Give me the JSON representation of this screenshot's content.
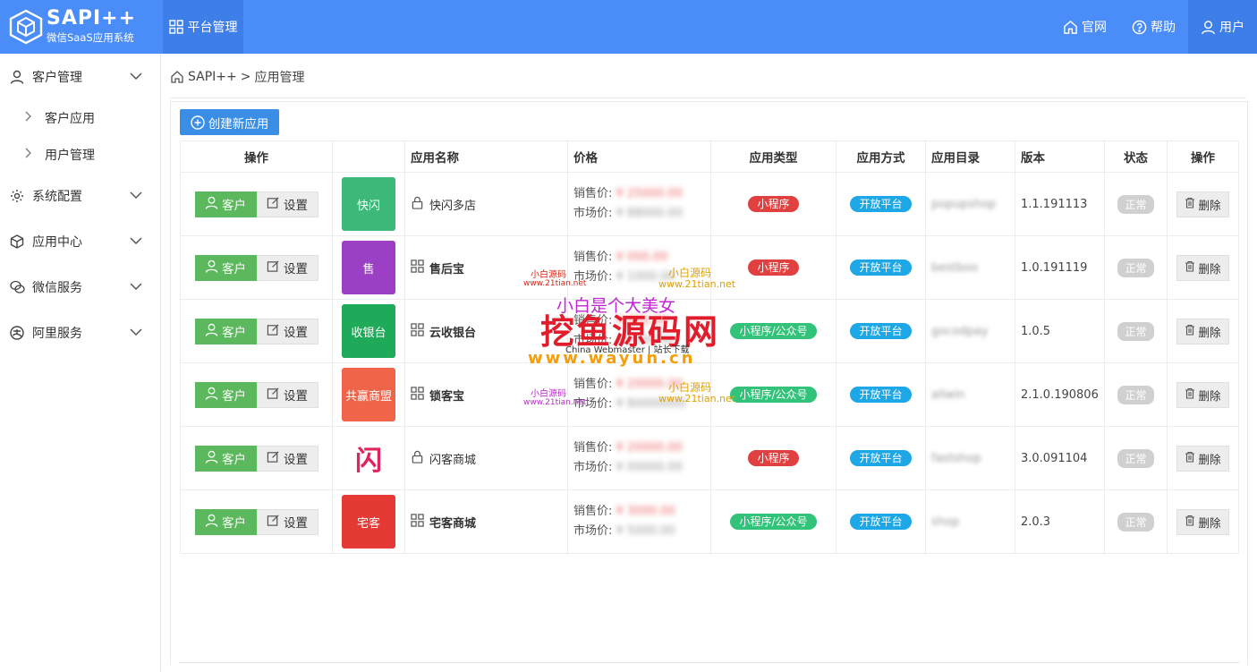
{
  "header": {
    "logo_title": "SAPI++",
    "logo_subtitle": "微信SaaS应用系统",
    "platform_nav": "平台管理",
    "links": [
      {
        "label": "官网",
        "icon": "home-icon"
      },
      {
        "label": "帮助",
        "icon": "help-icon"
      },
      {
        "label": "用户",
        "icon": "user-icon"
      }
    ]
  },
  "sidebar": {
    "groups": [
      {
        "label": "客户管理",
        "icon": "user-icon",
        "children": [
          "客户应用",
          "用户管理"
        ]
      },
      {
        "label": "系统配置",
        "icon": "gear-icon"
      },
      {
        "label": "应用中心",
        "icon": "cube-icon"
      },
      {
        "label": "微信服务",
        "icon": "wechat-icon"
      },
      {
        "label": "阿里服务",
        "icon": "alipay-icon"
      }
    ]
  },
  "breadcrumb": {
    "root": "SAPI++",
    "sep": ">",
    "current": "应用管理"
  },
  "toolbar": {
    "create_label": "创建新应用"
  },
  "table": {
    "headers": [
      "操作",
      "",
      "应用名称",
      "价格",
      "应用类型",
      "应用方式",
      "应用目录",
      "版本",
      "状态",
      "操作"
    ],
    "btn_customer": "客户",
    "btn_settings": "设置",
    "btn_delete": "删除",
    "price_sale_label": "销售价:",
    "price_market_label": "市场价:",
    "rows": [
      {
        "name": "快闪多店",
        "name_icon": "lock-icon",
        "bold": false,
        "icon_label": "快闪",
        "icon_color": "#3cb878",
        "sale": "¥ 25000.00",
        "market": "¥ 88000.00",
        "type": "小程序",
        "type_color": "red",
        "mode": "开放平台",
        "dir": "popupshop",
        "version": "1.1.191113",
        "status": "正常"
      },
      {
        "name": "售后宝",
        "name_icon": "grid-icon",
        "bold": true,
        "icon_label": "售",
        "icon_color": "#9b3fc4",
        "sale": "¥ 000.00",
        "market": "¥ 1000.00",
        "type": "小程序",
        "type_color": "red",
        "mode": "开放平台",
        "dir": "bestboo",
        "version": "1.0.191119",
        "status": "正常"
      },
      {
        "name": "云收银台",
        "name_icon": "grid-icon",
        "bold": true,
        "icon_label": "收银台",
        "icon_color": "#1faa59",
        "sale": "¥ 000.00",
        "market": "¥ 0000.00",
        "type": "小程序/公众号",
        "type_color": "green",
        "mode": "开放平台",
        "dir": "gocodpay",
        "version": "1.0.5",
        "status": "正常"
      },
      {
        "name": "锁客宝",
        "name_icon": "grid-icon",
        "bold": true,
        "icon_label": "共赢商盟",
        "icon_color": "#f0654a",
        "sale": "¥ 20000.00",
        "market": "¥ 80000000",
        "type": "小程序/公众号",
        "type_color": "green",
        "mode": "开放平台",
        "dir": "allwin",
        "version": "2.1.0.190806",
        "status": "正常"
      },
      {
        "name": "闪客商城",
        "name_icon": "lock-icon",
        "bold": false,
        "icon_label": "闪",
        "icon_color": "#ffffff",
        "sale": "¥ 20000.00",
        "market": "¥ 00000.00",
        "type": "小程序",
        "type_color": "red",
        "mode": "开放平台",
        "dir": "fastshop",
        "version": "3.0.091104",
        "status": "正常"
      },
      {
        "name": "宅客商城",
        "name_icon": "grid-icon",
        "bold": true,
        "icon_label": "宅客",
        "icon_color": "#e53935",
        "sale": "¥ 3000.00",
        "market": "¥ 5000.00",
        "type": "小程序/公众号",
        "type_color": "green",
        "mode": "开放平台",
        "dir": "shop",
        "version": "2.0.3",
        "status": "正常"
      }
    ]
  },
  "watermark": {
    "line1": "小白是个大美女",
    "line2": "挖鱼源码网",
    "line3": "China Webmaster | 站长下载",
    "line4": "www.wayun.cn",
    "tag1": "小白源码",
    "tag2": "www.21tian.net"
  }
}
